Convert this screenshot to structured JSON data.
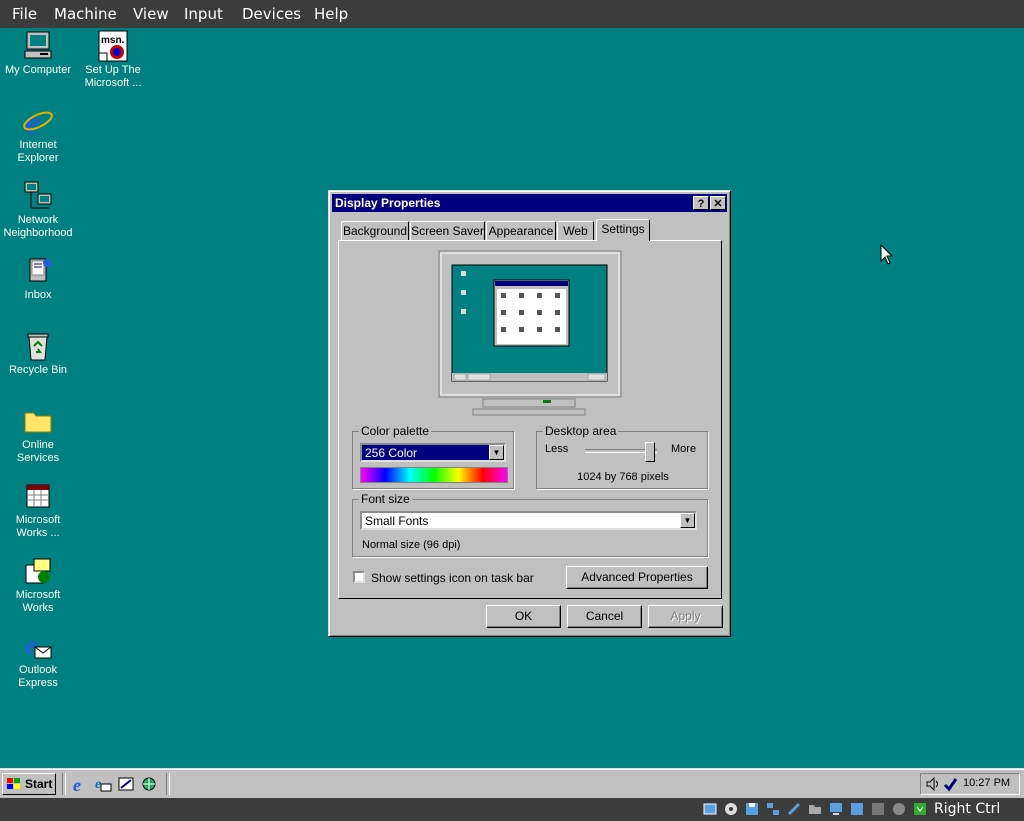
{
  "host_menu": [
    "File",
    "Machine",
    "View",
    "Input",
    "Devices",
    "Help"
  ],
  "desktop_icons": [
    {
      "label": "My Computer",
      "icon": "my-computer-icon"
    },
    {
      "label": "Set Up The Microsoft ...",
      "icon": "msn-setup-icon"
    },
    {
      "label": "Internet Explorer",
      "icon": "internet-explorer-icon"
    },
    {
      "label": "Network Neighborhood",
      "icon": "network-neighborhood-icon"
    },
    {
      "label": "Inbox",
      "icon": "inbox-icon"
    },
    {
      "label": "Recycle Bin",
      "icon": "recycle-bin-icon"
    },
    {
      "label": "Online Services",
      "icon": "folder-icon"
    },
    {
      "label": "Microsoft Works ...",
      "icon": "works-calendar-icon"
    },
    {
      "label": "Microsoft Works",
      "icon": "works-icon"
    },
    {
      "label": "Outlook Express",
      "icon": "outlook-express-icon"
    }
  ],
  "dialog": {
    "title": "Display Properties",
    "help_button": "?",
    "close_button": "✕",
    "tabs": [
      "Background",
      "Screen Saver",
      "Appearance",
      "Web",
      "Settings"
    ],
    "active_tab": "Settings",
    "color_palette": {
      "label": "Color palette",
      "value": "256 Color"
    },
    "desktop_area": {
      "label": "Desktop area",
      "less": "Less",
      "more": "More",
      "resolution": "1024 by 768 pixels",
      "slider_level": 1.0
    },
    "font_size": {
      "label": "Font size",
      "value": "Small Fonts",
      "note": "Normal size (96 dpi)"
    },
    "show_settings_icon": {
      "label": "Show settings icon on task bar",
      "checked": false
    },
    "advanced_button": "Advanced Properties",
    "ok": "OK",
    "cancel": "Cancel",
    "apply": "Apply"
  },
  "taskbar": {
    "start": "Start",
    "quicklaunch": [
      "internet-explorer-icon",
      "outlook-express-icon",
      "show-desktop-icon",
      "channels-icon"
    ],
    "clock": "10:27 PM"
  },
  "host_status": {
    "right_ctrl": "Right Ctrl"
  },
  "colors": {
    "desktop": "#008080",
    "titlebar": "#000080",
    "face": "#c0c0c0"
  }
}
